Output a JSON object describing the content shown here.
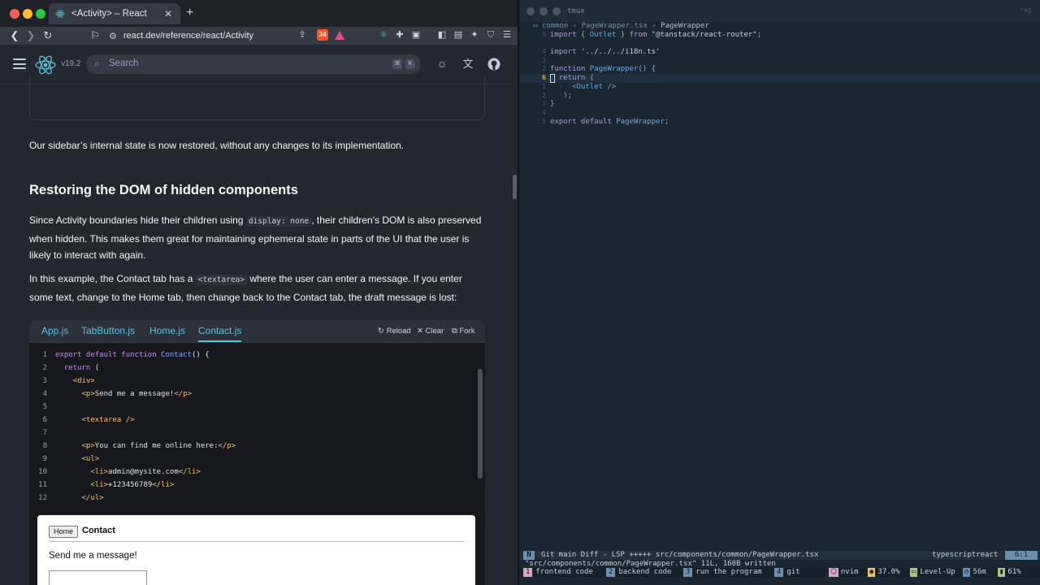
{
  "browser": {
    "tab_title": "<Activity> – React",
    "tab_close": "✕",
    "new_tab": "+",
    "url": "react.dev/reference/react/Activity",
    "extension_badge": "34"
  },
  "site": {
    "version": "v19.2",
    "search_placeholder": "Search",
    "kbd": [
      "⌘",
      "K"
    ]
  },
  "article": {
    "intro": "Our sidebar’s internal state is now restored, without any changes to its implementation.",
    "heading": "Restoring the DOM of hidden components",
    "p1_a": "Since Activity boundaries hide their children using ",
    "p1_code": "display: none",
    "p1_b": ", their children’s DOM is also preserved when hidden. This makes them great for maintaining ephemeral state in parts of the UI that the user is likely to interact with again.",
    "p2_a": "In this example, the Contact tab has a ",
    "p2_code": "<textarea>",
    "p2_b": " where the user can enter a message. If you enter some text, change to the Home tab, then change back to the Contact tab, the draft message is lost:"
  },
  "sandpack": {
    "tabs": [
      "App.js",
      "TabButton.js",
      "Home.js",
      "Contact.js"
    ],
    "reload": "Reload",
    "clear": "Clear",
    "fork": "Fork",
    "line_numbers": [
      "1",
      "2",
      "3",
      "4",
      "5",
      "6",
      "7",
      "8",
      "9",
      "10",
      "11",
      "12"
    ],
    "preview": {
      "home_button": "Home",
      "contact_label": "Contact",
      "message": "Send me a message!"
    }
  },
  "terminal": {
    "title": "tmux",
    "shortcut": "⌃⌘1",
    "breadcrumb": "common › PageWrapper.tsx › ",
    "breadcrumb_current": "PageWrapper",
    "line_numbers": [
      "5",
      "4",
      "3",
      "2",
      "1",
      "6",
      "1",
      "2",
      "3",
      "4",
      "5"
    ],
    "lines": [
      "import { Outlet } from \"@tanstack/react-router\";",
      "",
      "import '../../../i18n.ts'",
      "",
      "function PageWrapper() {",
      "  return (",
      "    <Outlet />",
      "  );",
      "}",
      "",
      "export default PageWrapper;"
    ],
    "status": {
      "mode": "N",
      "git": "Git main Diff - LSP +++++  src/components/common/PageWrapper.tsx",
      "filetype": "typescriptreact",
      "position": "6:1"
    },
    "message": "\"src/components/common/PageWrapper.tsx\" 11L, 160B written",
    "tmux_windows": [
      {
        "num": "1",
        "name": "frontend code"
      },
      {
        "num": "2",
        "name": "backend code"
      },
      {
        "num": "3",
        "name": "run the program"
      },
      {
        "num": "4",
        "name": "git"
      }
    ],
    "tmux_right": {
      "nvim": "nvim",
      "cpu": "37.0%",
      "level": "Level-Up",
      "time": "56m",
      "battery": "61%"
    }
  },
  "colors": {
    "accent": "#58c4dc",
    "page_bg": "#23272f",
    "terminal_bg": "#1a2631"
  }
}
